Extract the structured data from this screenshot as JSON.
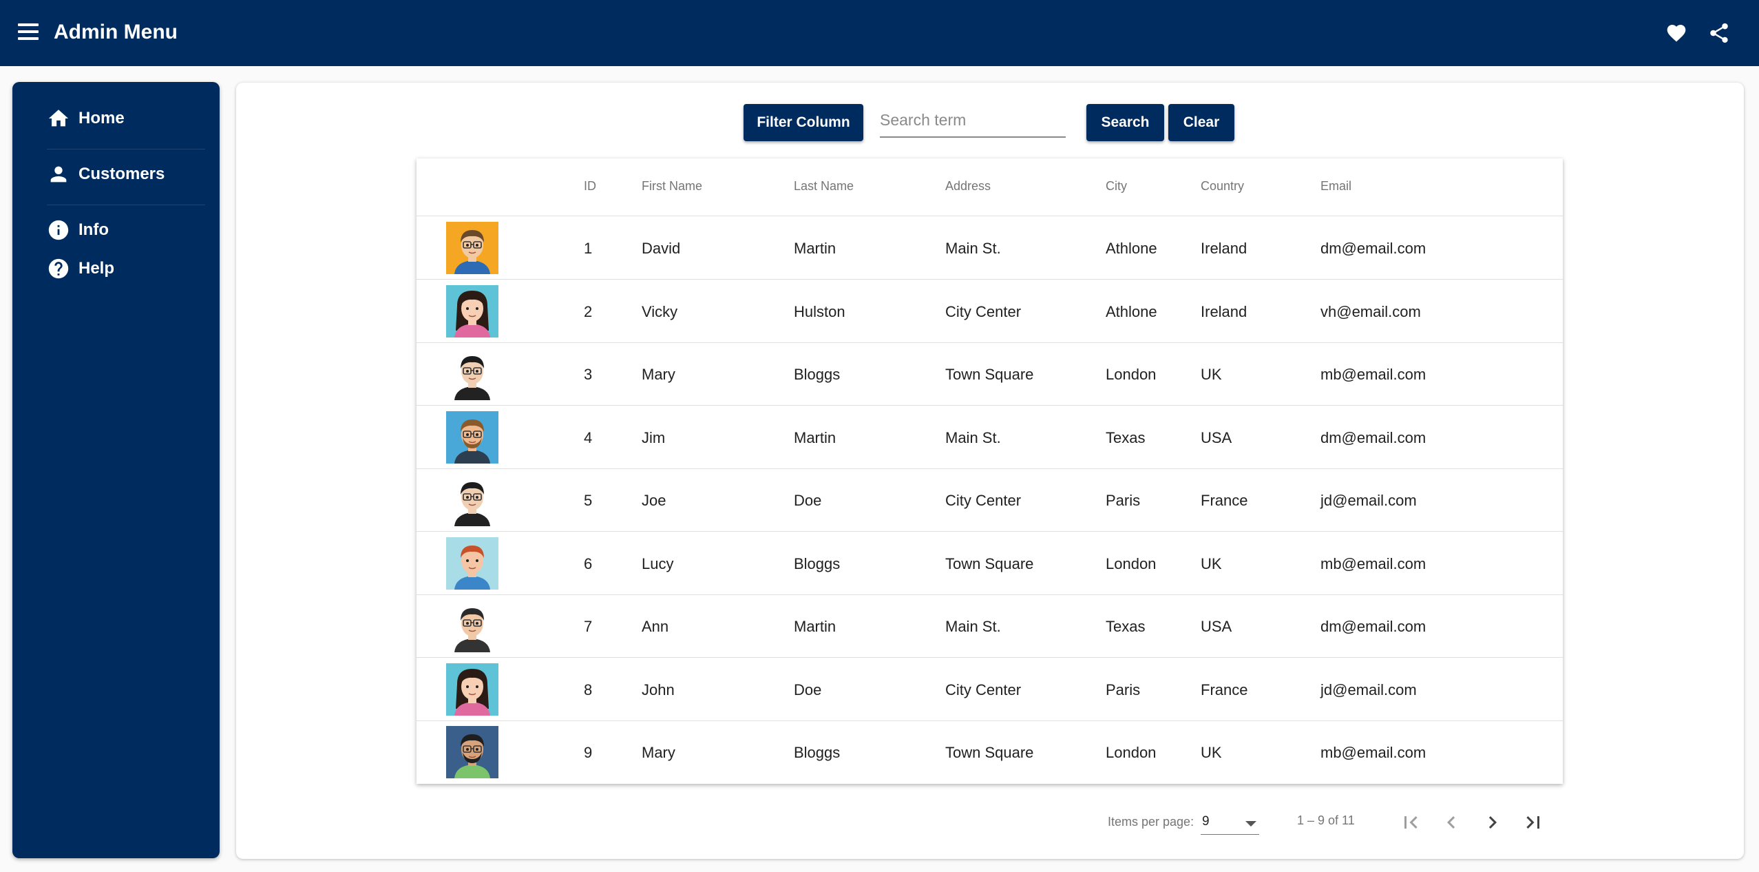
{
  "app": {
    "title": "Admin Menu"
  },
  "theme": {
    "primary": "#002b5f",
    "surface": "#ffffff",
    "background": "#fafafa"
  },
  "topbar_icons": [
    "menu-icon",
    "heart-icon",
    "share-icon"
  ],
  "sidebar": {
    "items": [
      {
        "label": "Home",
        "icon": "home-icon"
      },
      {
        "label": "Customers",
        "icon": "person-icon"
      },
      {
        "label": "Info",
        "icon": "info-icon"
      },
      {
        "label": "Help",
        "icon": "help-icon"
      }
    ]
  },
  "toolbar": {
    "filter_label": "Filter Column",
    "search_placeholder": "Search term",
    "search_value": "",
    "search_label": "Search",
    "clear_label": "Clear"
  },
  "table": {
    "columns": [
      "",
      "ID",
      "First Name",
      "Last Name",
      "Address",
      "City",
      "Country",
      "Email"
    ],
    "rows": [
      {
        "avatar": "avatar-glasses-orange",
        "id": "1",
        "first": "David",
        "last": "Martin",
        "address": "Main St.",
        "city": "Athlone",
        "country": "Ireland",
        "email": "dm@email.com"
      },
      {
        "avatar": "avatar-woman-teal",
        "id": "2",
        "first": "Vicky",
        "last": "Hulston",
        "address": "City Center",
        "city": "Athlone",
        "country": "Ireland",
        "email": "vh@email.com"
      },
      {
        "avatar": "avatar-dark-hair-white",
        "id": "3",
        "first": "Mary",
        "last": "Bloggs",
        "address": "Town Square",
        "city": "London",
        "country": "UK",
        "email": "mb@email.com"
      },
      {
        "avatar": "avatar-beard-blue",
        "id": "4",
        "first": "Jim",
        "last": "Martin",
        "address": "Main St.",
        "city": "Texas",
        "country": "USA",
        "email": "dm@email.com"
      },
      {
        "avatar": "avatar-dark-hair-white",
        "id": "5",
        "first": "Joe",
        "last": "Doe",
        "address": "City Center",
        "city": "Paris",
        "country": "France",
        "email": "jd@email.com"
      },
      {
        "avatar": "avatar-redhead-lightblue",
        "id": "6",
        "first": "Lucy",
        "last": "Bloggs",
        "address": "Town Square",
        "city": "London",
        "country": "UK",
        "email": "mb@email.com"
      },
      {
        "avatar": "avatar-glasses-white",
        "id": "7",
        "first": "Ann",
        "last": "Martin",
        "address": "Main St.",
        "city": "Texas",
        "country": "USA",
        "email": "dm@email.com"
      },
      {
        "avatar": "avatar-woman-teal",
        "id": "8",
        "first": "John",
        "last": "Doe",
        "address": "City Center",
        "city": "Paris",
        "country": "France",
        "email": "jd@email.com"
      },
      {
        "avatar": "avatar-glasses-navy",
        "id": "9",
        "first": "Mary",
        "last": "Bloggs",
        "address": "Town Square",
        "city": "London",
        "country": "UK",
        "email": "mb@email.com"
      }
    ]
  },
  "paginator": {
    "items_per_page_label": "Items per page:",
    "items_per_page_value": "9",
    "range_label": "1 – 9 of 11",
    "buttons": [
      "first-page-icon",
      "previous-page-icon",
      "next-page-icon",
      "last-page-icon"
    ]
  }
}
